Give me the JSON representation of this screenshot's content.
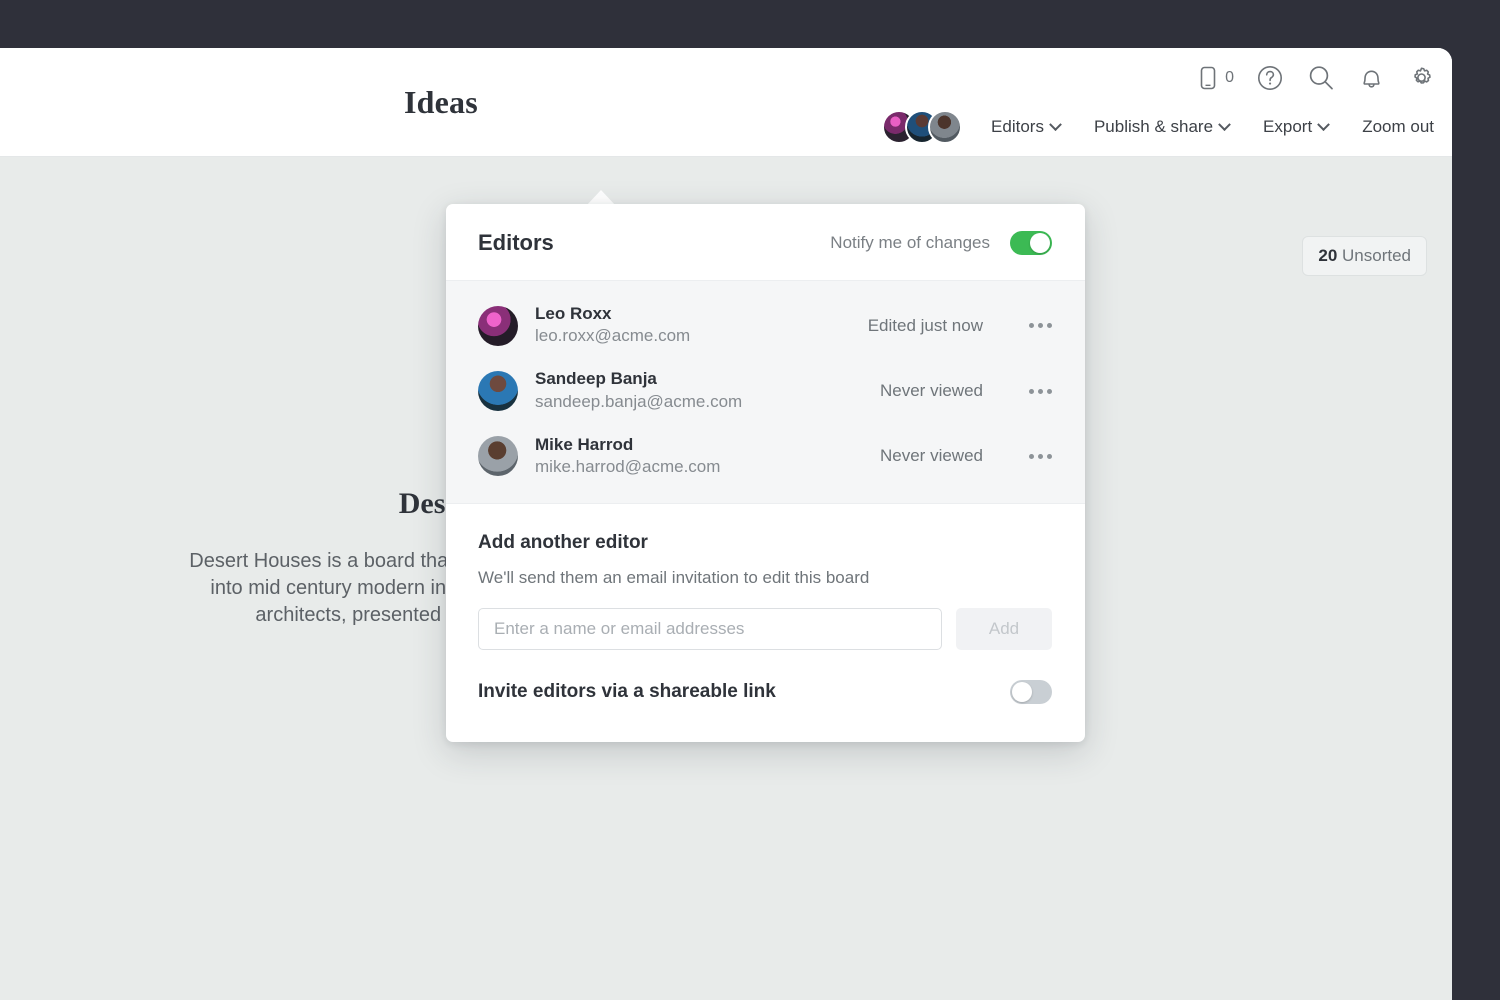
{
  "utility_bar": [
    {
      "icon": "mobile-device-icon",
      "count": "0"
    },
    {
      "icon": "help-circle-icon"
    },
    {
      "icon": "search-icon"
    },
    {
      "icon": "bell-icon"
    },
    {
      "icon": "gear-icon"
    }
  ],
  "header": {
    "board_title": "Ideas",
    "nav": [
      {
        "label": "Editors",
        "caret": true
      },
      {
        "label": "Publish & share",
        "caret": true
      },
      {
        "label": "Export",
        "caret": true
      },
      {
        "label": "Zoom out",
        "caret": false
      }
    ]
  },
  "canvas": {
    "unsorted_count": "20",
    "unsorted_label": "Unsorted",
    "hero": {
      "title": "Desert Houses",
      "body": "Desert Houses is a board that explores the history of design. It goes into mid century modern in Palm Springs. Some of the top local architects, presented in a home or landscape setting."
    }
  },
  "popover": {
    "title": "Editors",
    "notify_label": "Notify me of changes",
    "notify_on": true,
    "editors": [
      {
        "name": "Leo Roxx",
        "email": "leo.roxx@acme.com",
        "status": "Edited just now",
        "avatar_color_a": "#d34fb5",
        "avatar_color_b": "#2b2230"
      },
      {
        "name": "Sandeep Banja",
        "email": "sandeep.banja@acme.com",
        "status": "Never viewed",
        "avatar_color_a": "#2b6fa8",
        "avatar_color_b": "#24323d"
      },
      {
        "name": "Mike Harrod",
        "email": "mike.harrod@acme.com",
        "status": "Never viewed",
        "avatar_color_a": "#8d949c",
        "avatar_color_b": "#3a2c26"
      }
    ],
    "add_section": {
      "title": "Add another editor",
      "subtitle": "We'll send them an email invitation to edit this board",
      "input_value": "",
      "input_placeholder": "Enter a name or email addresses",
      "button_label": "Add"
    },
    "share": {
      "label": "Invite editors via a shareable link",
      "toggle_on": false
    }
  },
  "colors": {
    "chrome_dark": "#2f303a",
    "canvas": "#e8ebea",
    "toggle_on": "#3cba54",
    "toggle_off": "#c9cfd4"
  }
}
